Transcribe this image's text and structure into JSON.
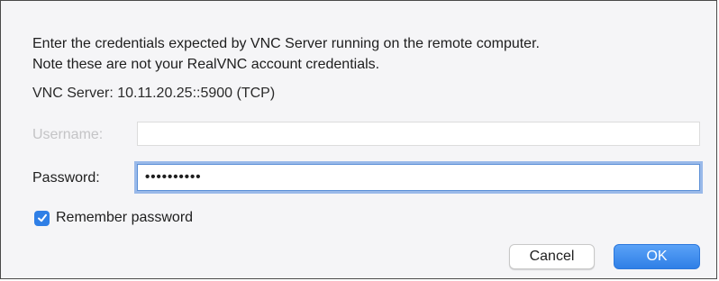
{
  "dialog": {
    "intro_line1": "Enter the credentials expected by VNC Server running on the remote computer.",
    "intro_line2": "Note these are not your RealVNC account credentials.",
    "server_info": "VNC Server: 10.11.20.25::5900 (TCP)"
  },
  "username": {
    "label": "Username:",
    "value": ""
  },
  "password": {
    "label": "Password:",
    "value": "••••••••••"
  },
  "remember": {
    "label": "Remember password",
    "checked": true,
    "icon": "checkmark-icon"
  },
  "buttons": {
    "cancel_label": "Cancel",
    "ok_label": "OK"
  },
  "colors": {
    "accent": "#2f7fe6",
    "focus_ring": "#4c87df",
    "disabled_text": "#c4c4c6"
  }
}
